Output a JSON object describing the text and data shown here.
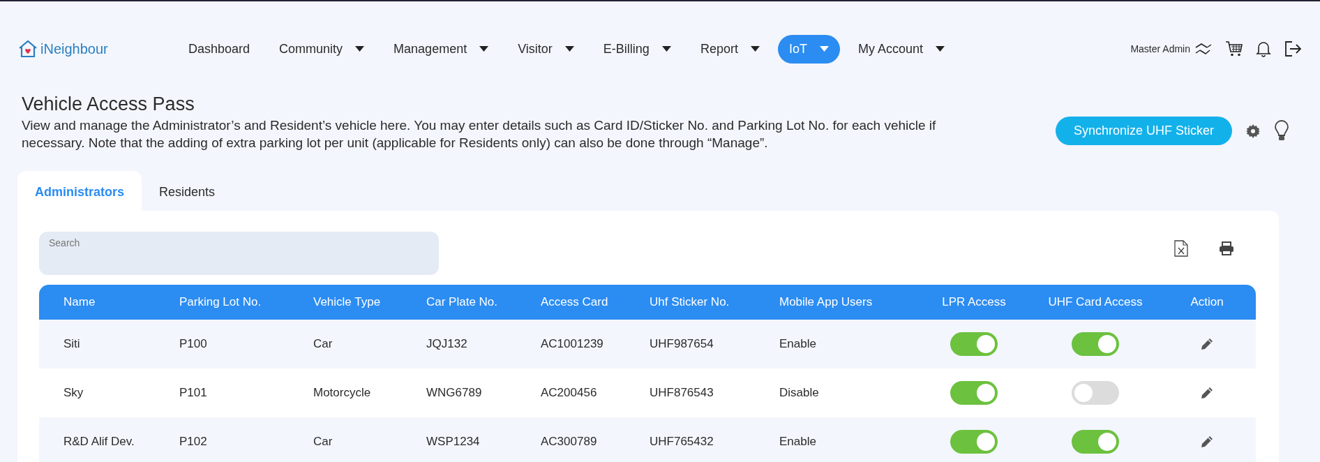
{
  "brand": "iNeighbour",
  "nav": [
    {
      "label": "Dashboard",
      "dropdown": false,
      "selected": false
    },
    {
      "label": "Community",
      "dropdown": true,
      "selected": false
    },
    {
      "label": "Management",
      "dropdown": true,
      "selected": false
    },
    {
      "label": "Visitor",
      "dropdown": true,
      "selected": false
    },
    {
      "label": "E-Billing",
      "dropdown": true,
      "selected": false
    },
    {
      "label": "Report",
      "dropdown": true,
      "selected": false
    },
    {
      "label": "IoT",
      "dropdown": true,
      "selected": true
    },
    {
      "label": "My Account",
      "dropdown": true,
      "selected": false
    }
  ],
  "user": "Master Admin",
  "page": {
    "title": "Vehicle Access Pass",
    "description": "View and manage the Administrator’s and Resident’s vehicle here. You may enter details such as Card ID/Sticker No. and Parking Lot No. for each vehicle if necessary. Note that the adding of extra parking lot per unit (applicable for Residents only) can also be done through “Manage”.",
    "sync_button": "Synchronize UHF Sticker"
  },
  "tabs": [
    {
      "label": "Administrators",
      "selected": true
    },
    {
      "label": "Residents",
      "selected": false
    }
  ],
  "search": {
    "placeholder": "Search"
  },
  "table": {
    "columns": [
      "Name",
      "Parking Lot No.",
      "Vehicle Type",
      "Car Plate No.",
      "Access Card",
      "Uhf Sticker No.",
      "Mobile App Users",
      "LPR Access",
      "UHF Card Access",
      "Action"
    ],
    "rows": [
      {
        "name": "Siti",
        "parking_lot": "P100",
        "vehicle_type": "Car",
        "car_plate": "JQJ132",
        "access_card": "AC1001239",
        "uhf_sticker": "UHF987654",
        "mobile_app": "Enable",
        "lpr_access": true,
        "uhf_card_access": true
      },
      {
        "name": "Sky",
        "parking_lot": "P101",
        "vehicle_type": "Motorcycle",
        "car_plate": "WNG6789",
        "access_card": "AC200456",
        "uhf_sticker": "UHF876543",
        "mobile_app": "Disable",
        "lpr_access": true,
        "uhf_card_access": false
      },
      {
        "name": "R&D Alif Dev.",
        "parking_lot": "P102",
        "vehicle_type": "Car",
        "car_plate": "WSP1234",
        "access_card": "AC300789",
        "uhf_sticker": "UHF765432",
        "mobile_app": "Enable",
        "lpr_access": true,
        "uhf_card_access": true
      }
    ]
  }
}
